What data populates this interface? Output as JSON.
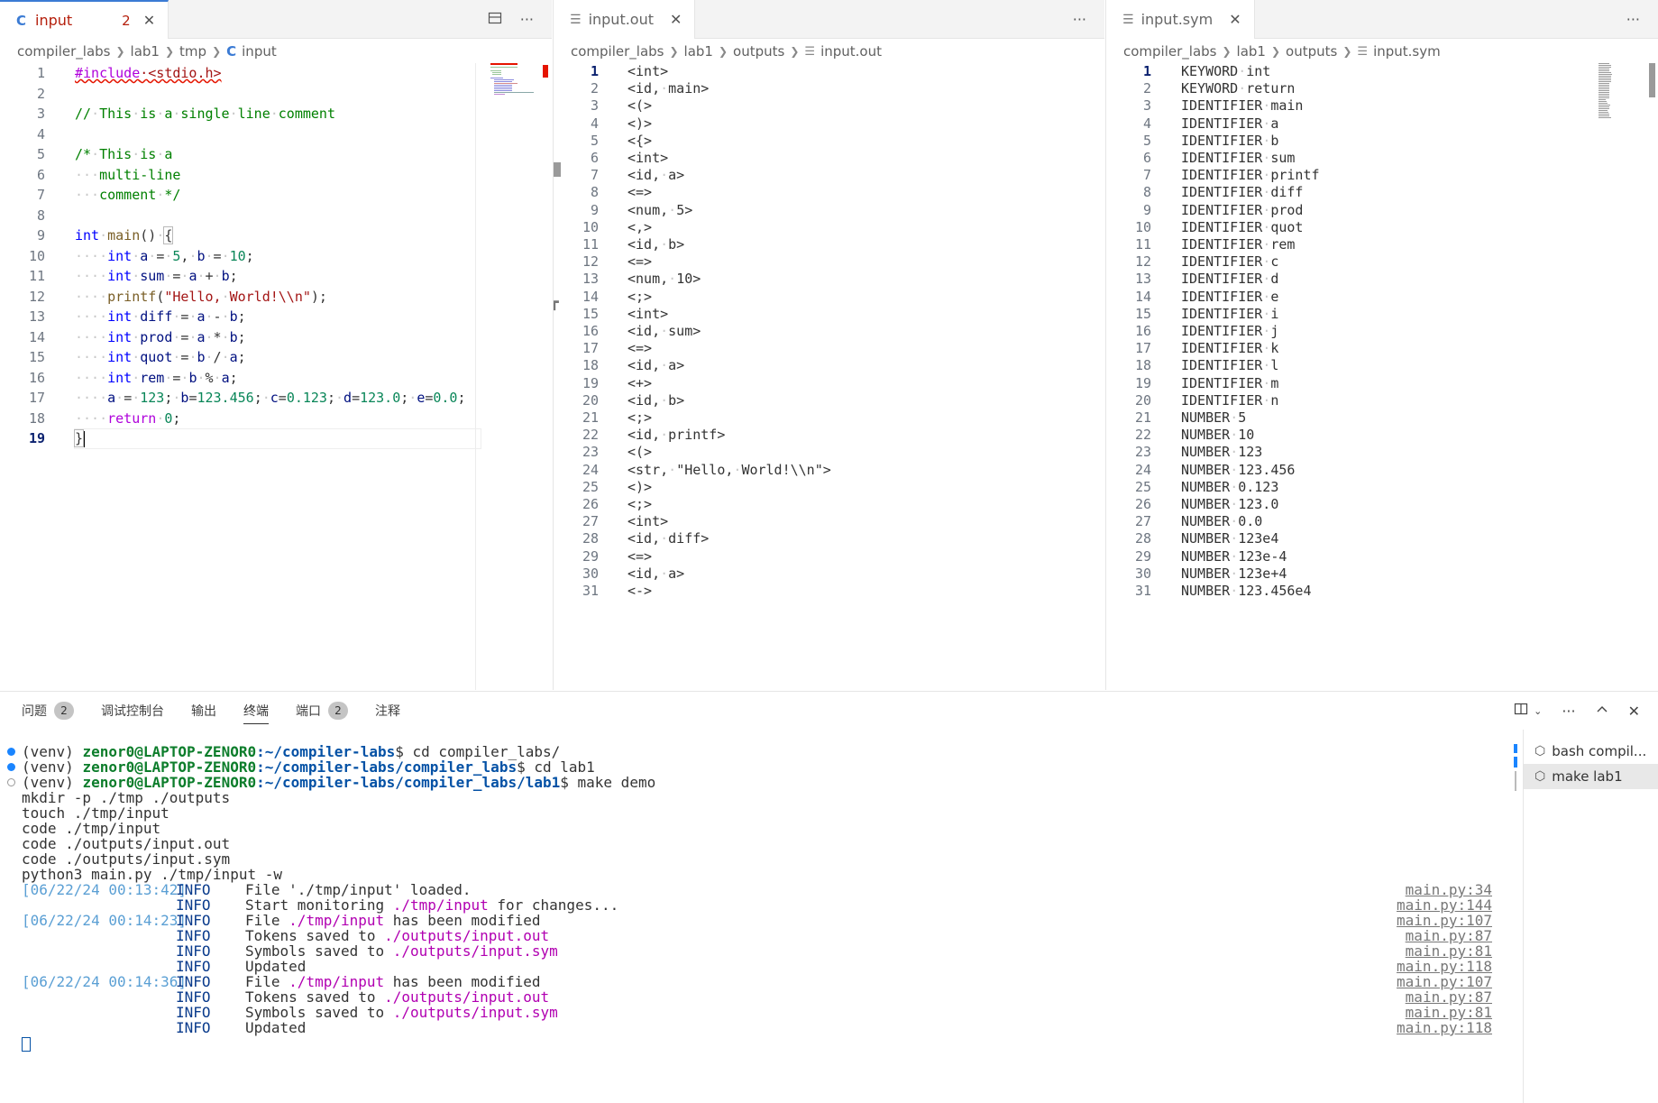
{
  "pane1": {
    "tab": {
      "icon": "C",
      "label": "input",
      "problems": "2",
      "close": "✕"
    },
    "breadcrumb": [
      "compiler_labs",
      "lab1",
      "tmp"
    ],
    "breadcrumb_file": "input",
    "lines": [
      {
        "n": "1"
      },
      {
        "n": "2"
      },
      {
        "n": "3"
      },
      {
        "n": "4"
      },
      {
        "n": "5"
      },
      {
        "n": "6"
      },
      {
        "n": "7"
      },
      {
        "n": "8"
      },
      {
        "n": "9"
      },
      {
        "n": "10"
      },
      {
        "n": "11"
      },
      {
        "n": "12"
      },
      {
        "n": "13"
      },
      {
        "n": "14"
      },
      {
        "n": "15"
      },
      {
        "n": "16"
      },
      {
        "n": "17"
      },
      {
        "n": "18"
      },
      {
        "n": "19"
      }
    ]
  },
  "pane2": {
    "tab": {
      "label": "input.out",
      "close": "✕"
    },
    "breadcrumb": [
      "compiler_labs",
      "lab1",
      "outputs"
    ],
    "breadcrumb_file": "input.out",
    "lines": [
      "<int>",
      "<id, main>",
      "<(>",
      "<)>",
      "<{>",
      "<int>",
      "<id, a>",
      "<=>",
      "<num, 5>",
      "<,>",
      "<id, b>",
      "<=>",
      "<num, 10>",
      "<;>",
      "<int>",
      "<id, sum>",
      "<=>",
      "<id, a>",
      "<+>",
      "<id, b>",
      "<;>",
      "<id, printf>",
      "<(>",
      "<str, \"Hello, World!\\\\n\">",
      "<)>",
      "<;>",
      "<int>",
      "<id, diff>",
      "<=>",
      "<id, a>",
      "<->"
    ]
  },
  "pane3": {
    "tab": {
      "label": "input.sym",
      "close": "✕"
    },
    "breadcrumb": [
      "compiler_labs",
      "lab1",
      "outputs"
    ],
    "breadcrumb_file": "input.sym",
    "lines": [
      "KEYWORD int",
      "KEYWORD return",
      "IDENTIFIER main",
      "IDENTIFIER a",
      "IDENTIFIER b",
      "IDENTIFIER sum",
      "IDENTIFIER printf",
      "IDENTIFIER diff",
      "IDENTIFIER prod",
      "IDENTIFIER quot",
      "IDENTIFIER rem",
      "IDENTIFIER c",
      "IDENTIFIER d",
      "IDENTIFIER e",
      "IDENTIFIER i",
      "IDENTIFIER j",
      "IDENTIFIER k",
      "IDENTIFIER l",
      "IDENTIFIER m",
      "IDENTIFIER n",
      "NUMBER 5",
      "NUMBER 10",
      "NUMBER 123",
      "NUMBER 123.456",
      "NUMBER 0.123",
      "NUMBER 123.0",
      "NUMBER 0.0",
      "NUMBER 123e4",
      "NUMBER 123e-4",
      "NUMBER 123e+4",
      "NUMBER 123.456e4"
    ]
  },
  "panel": {
    "tabs": [
      {
        "label": "问题",
        "badge": "2"
      },
      {
        "label": "调试控制台"
      },
      {
        "label": "输出"
      },
      {
        "label": "终端"
      },
      {
        "label": "端口",
        "badge": "2"
      },
      {
        "label": "注释"
      }
    ],
    "terminals": [
      "bash compil...",
      "make lab1"
    ]
  },
  "terminal": {
    "prompts": [
      {
        "env": "(venv) ",
        "user": "zenor0@LAPTOP-ZENOR0",
        "path": ":~/compiler-labs",
        "cmd": "$ cd compiler_labs/"
      },
      {
        "env": "(venv) ",
        "user": "zenor0@LAPTOP-ZENOR0",
        "path": ":~/compiler-labs/compiler_labs",
        "cmd": "$ cd lab1"
      },
      {
        "env": "(venv) ",
        "user": "zenor0@LAPTOP-ZENOR0",
        "path": ":~/compiler-labs/compiler_labs/lab1",
        "cmd": "$ make demo"
      }
    ],
    "plain": [
      "mkdir -p ./tmp ./outputs",
      "touch ./tmp/input",
      "code ./tmp/input",
      "code ./outputs/input.out",
      "code ./outputs/input.sym",
      "python3 main.py ./tmp/input -w"
    ],
    "logs": [
      {
        "time": "[06/22/24 00:13:42]",
        "level": "INFO",
        "pre": "File '",
        "hl": "./tmp/input",
        "post": "' loaded.",
        "hl_color": "plain",
        "src": "main.py:34"
      },
      {
        "time": "",
        "level": "INFO",
        "pre": "Start monitoring ",
        "hl": "./tmp/input",
        "post": " for changes...",
        "hl_color": "mag",
        "src": "main.py:144"
      },
      {
        "time": "[06/22/24 00:14:23]",
        "level": "INFO",
        "pre": "File ",
        "hl": "./tmp/input",
        "post": " has been modified",
        "hl_color": "mag",
        "src": "main.py:107"
      },
      {
        "time": "",
        "level": "INFO",
        "pre": "Tokens saved to ",
        "hl": "./outputs/input.out",
        "post": "",
        "hl_color": "mag",
        "src": "main.py:87"
      },
      {
        "time": "",
        "level": "INFO",
        "pre": "Symbols saved to ",
        "hl": "./outputs/input.sym",
        "post": "",
        "hl_color": "mag",
        "src": "main.py:81"
      },
      {
        "time": "",
        "level": "INFO",
        "pre": "Updated",
        "hl": "",
        "post": "",
        "hl_color": "mag",
        "src": "main.py:118"
      },
      {
        "time": "[06/22/24 00:14:36]",
        "level": "INFO",
        "pre": "File ",
        "hl": "./tmp/input",
        "post": " has been modified",
        "hl_color": "mag",
        "src": "main.py:107"
      },
      {
        "time": "",
        "level": "INFO",
        "pre": "Tokens saved to ",
        "hl": "./outputs/input.out",
        "post": "",
        "hl_color": "mag",
        "src": "main.py:87"
      },
      {
        "time": "",
        "level": "INFO",
        "pre": "Symbols saved to ",
        "hl": "./outputs/input.sym",
        "post": "",
        "hl_color": "mag",
        "src": "main.py:81"
      },
      {
        "time": "",
        "level": "INFO",
        "pre": "Updated",
        "hl": "",
        "post": "",
        "hl_color": "mag",
        "src": "main.py:118"
      }
    ]
  },
  "colors": {
    "accent": "#3b7bd4",
    "error": "#e51400",
    "terminal_user": "#0c7d2b",
    "terminal_path": "#0451a5"
  }
}
